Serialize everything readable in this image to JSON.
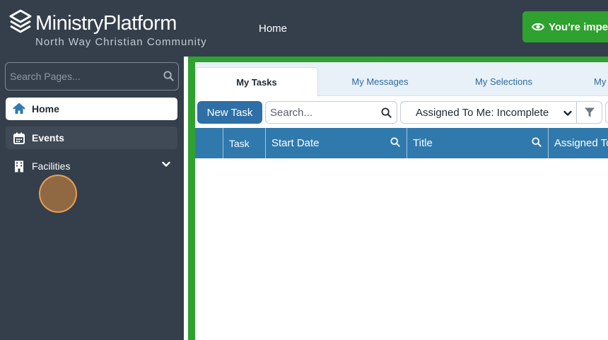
{
  "app": {
    "brand": "MinistryPlatform",
    "organization": "North Way Christian Community",
    "top_nav_home": "Home",
    "impersonation_text": "You're impersonating"
  },
  "sidebar": {
    "search_placeholder": "Search Pages...",
    "items": [
      {
        "label": "Home",
        "icon": "home-icon",
        "active": true
      },
      {
        "label": "Events",
        "icon": "calendar-icon",
        "active": false
      },
      {
        "label": "Facilities",
        "icon": "building-icon",
        "active": false
      }
    ]
  },
  "tabs": [
    "My Tasks",
    "My Messages",
    "My Selections",
    "My"
  ],
  "toolbar": {
    "new_task_label": "New Task",
    "search_placeholder": "Search...",
    "selected_view": "Assigned To Me: Incomplete"
  },
  "table": {
    "columns": [
      "Task",
      "Start Date",
      "Title",
      "Assigned To"
    ]
  },
  "colors": {
    "sidebar_bg": "#343f4b",
    "accent_green": "#2fa12e",
    "primary_blue": "#2f79ad",
    "button_blue": "#2d6fa6"
  }
}
